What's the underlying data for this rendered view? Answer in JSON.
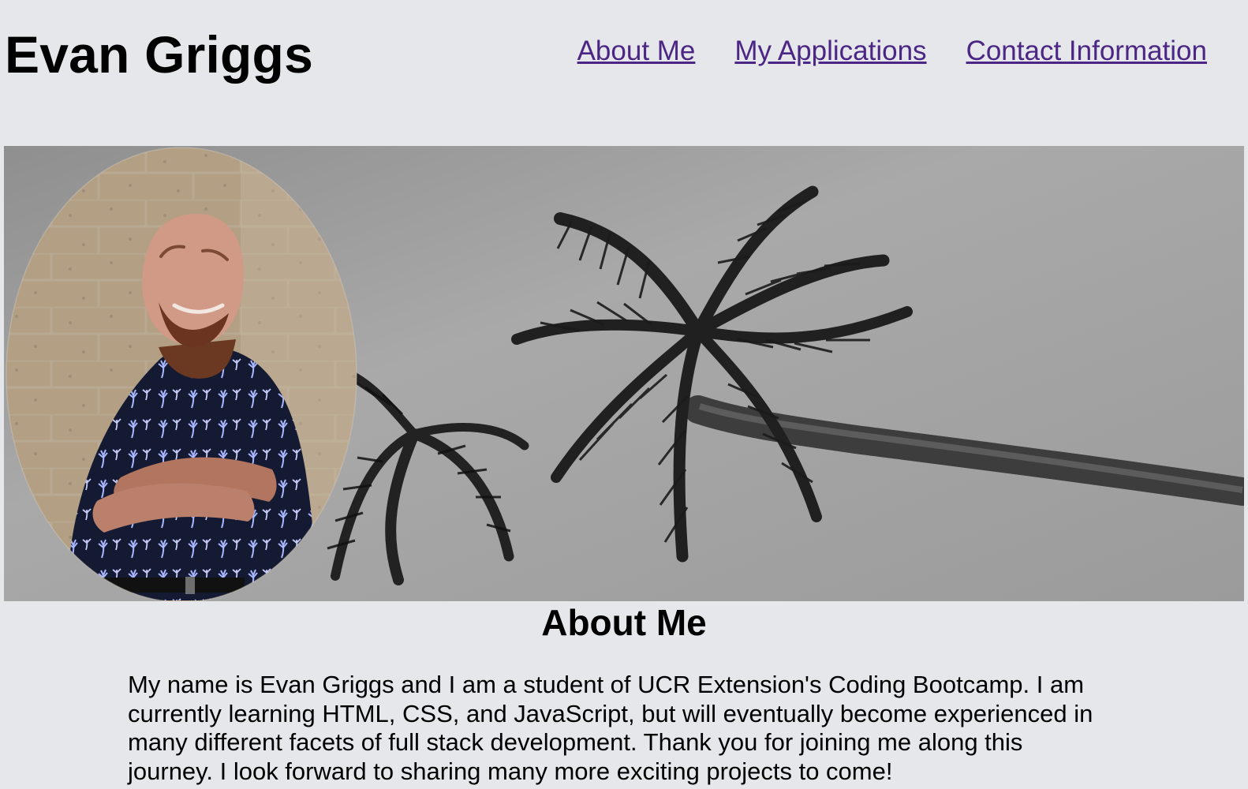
{
  "header": {
    "title": "Evan Griggs"
  },
  "nav": {
    "items": [
      {
        "label": "About Me"
      },
      {
        "label": "My Applications"
      },
      {
        "label": "Contact Information"
      }
    ]
  },
  "hero": {
    "portrait_icon": "portrait-photo",
    "background_icon": "palm-tree-photo"
  },
  "about": {
    "heading": "About Me",
    "body": "My name is Evan Griggs and I am a student of UCR Extension's Coding Bootcamp. I am currently learning HTML, CSS, and JavaScript, but will eventually become experienced in many different facets of full stack development. Thank you for joining me along this journey. I look forward to sharing many more exciting projects to come!"
  },
  "colors": {
    "background": "#e6e7ea",
    "link": "#4b2684",
    "text": "#000000"
  }
}
